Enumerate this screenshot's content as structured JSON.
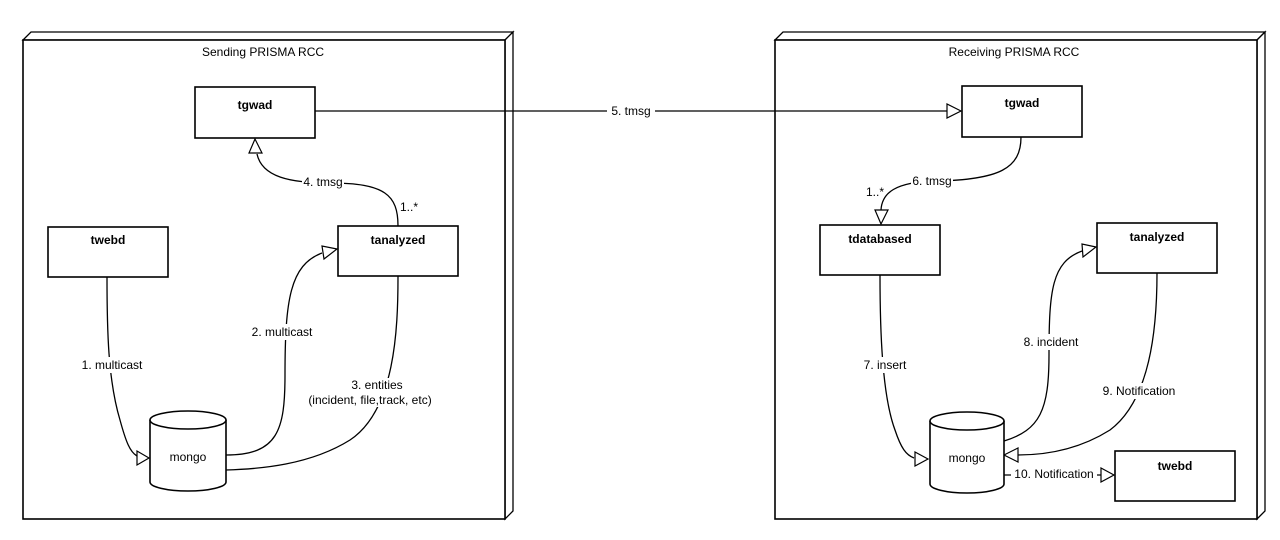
{
  "frames": {
    "sending": {
      "title": "Sending PRISMA RCC"
    },
    "receiving": {
      "title": "Receiving PRISMA RCC"
    }
  },
  "nodes": {
    "s_tgwad": "tgwad",
    "s_twebd": "twebd",
    "s_tanalyzed": "tanalyzed",
    "s_mongo": "mongo",
    "r_tgwad": "tgwad",
    "r_tdatabased": "tdatabased",
    "r_tanalyzed": "tanalyzed",
    "r_mongo": "mongo",
    "r_twebd": "twebd"
  },
  "edges": {
    "e1": "1. multicast",
    "e2": "2. multicast",
    "e3a": "3. entities",
    "e3b": "(incident, file,track, etc)",
    "e4": "4. tmsg",
    "e4m": "1..*",
    "e5": "5. tmsg",
    "e6": "6. tmsg",
    "e6m": "1..*",
    "e7": "7. insert",
    "e8": "8. incident",
    "e9": "9. Notification",
    "e10": "10. Notification"
  }
}
